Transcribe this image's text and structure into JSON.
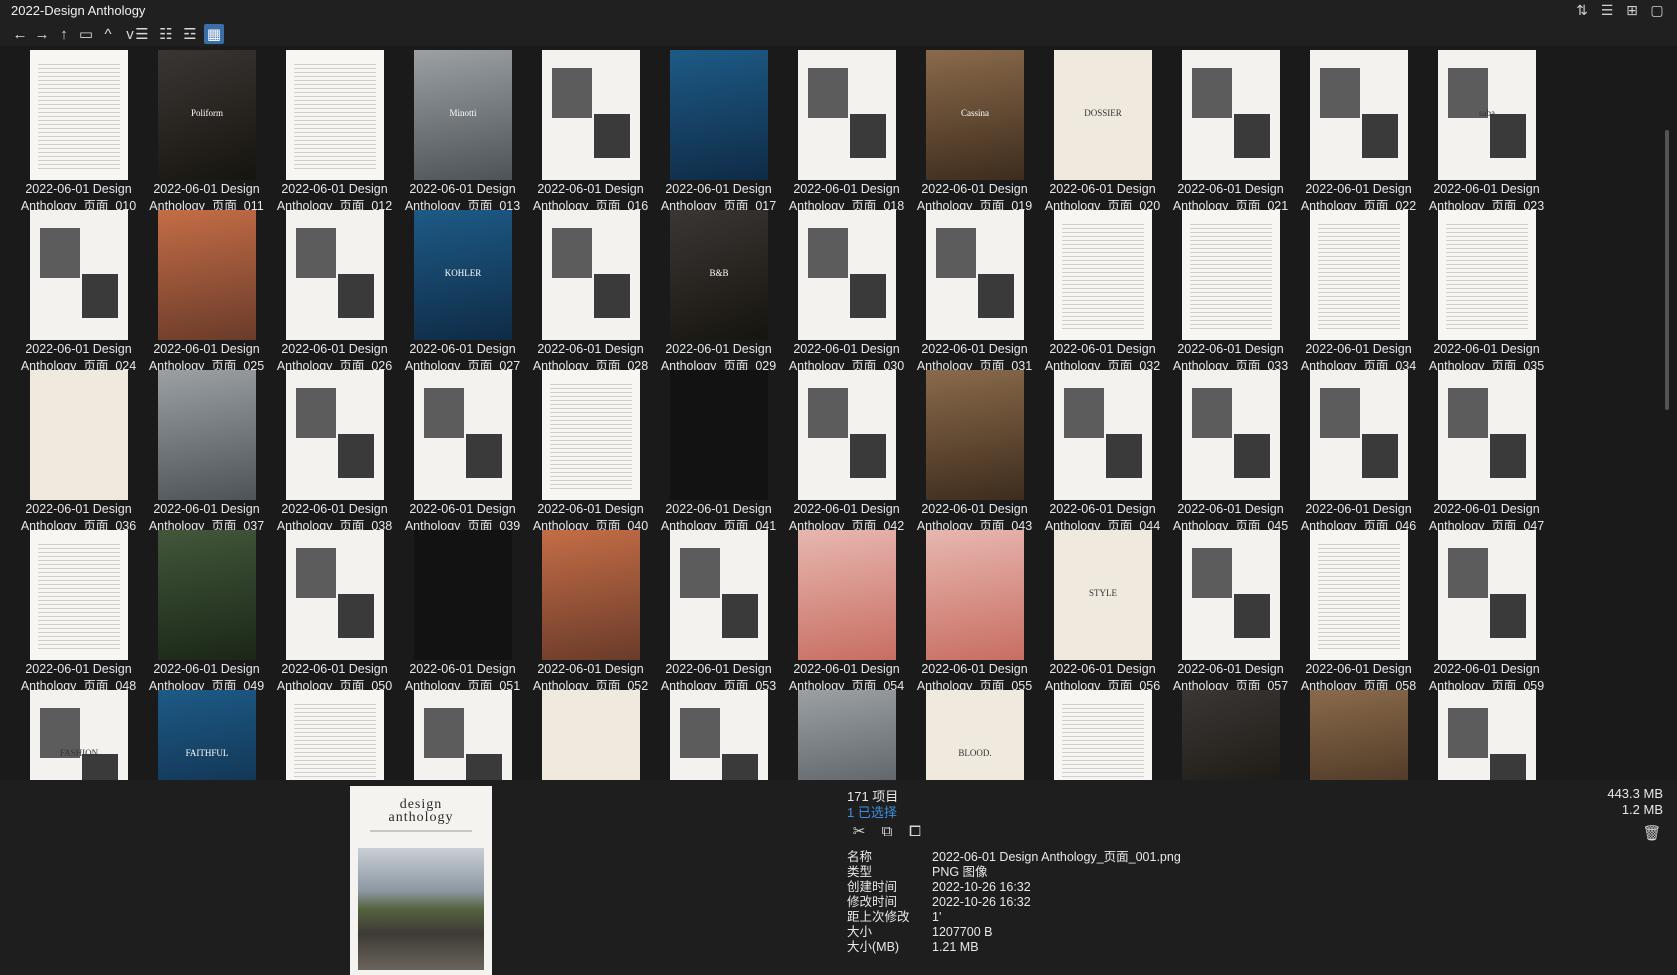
{
  "window": {
    "title": "2022-Design Anthology"
  },
  "toolbar": {
    "back": "←",
    "forward": "→",
    "up": "↑",
    "folder": "▭",
    "caret_up": "^",
    "caret_down": "v",
    "view_list": "☰",
    "view_detail": "☷",
    "view_tiles": "☲",
    "view_thumbs": "▦"
  },
  "titlebar_icons": [
    "⇅",
    "☰",
    "⊞",
    "▢"
  ],
  "files": [
    {
      "line1": "2022-06-01 Design",
      "line2": "Anthology_页面_010",
      "style": "t-text"
    },
    {
      "line1": "2022-06-01 Design",
      "line2": "Anthology_页面_011",
      "style": "t-dark",
      "label": "Poliform"
    },
    {
      "line1": "2022-06-01 Design",
      "line2": "Anthology_页面_012",
      "style": "t-text"
    },
    {
      "line1": "2022-06-01 Design",
      "line2": "Anthology_页面_013",
      "style": "t-grey",
      "label": "Minotti"
    },
    {
      "line1": "2022-06-01 Design",
      "line2": "Anthology_页面_016",
      "style": "t-mag"
    },
    {
      "line1": "2022-06-01 Design",
      "line2": "Anthology_页面_017",
      "style": "t-blue"
    },
    {
      "line1": "2022-06-01 Design",
      "line2": "Anthology_页面_018",
      "style": "t-mag"
    },
    {
      "line1": "2022-06-01 Design",
      "line2": "Anthology_页面_019",
      "style": "t-wood",
      "label": "Cassina"
    },
    {
      "line1": "2022-06-01 Design",
      "line2": "Anthology_页面_020",
      "style": "t-cream",
      "label": "DOSSIER"
    },
    {
      "line1": "2022-06-01 Design",
      "line2": "Anthology_页面_021",
      "style": "t-mag"
    },
    {
      "line1": "2022-06-01 Design",
      "line2": "Anthology_页面_022",
      "style": "t-mag"
    },
    {
      "line1": "2022-06-01 Design",
      "line2": "Anthology_页面_023",
      "style": "t-mag",
      "label": "saba"
    },
    {
      "line1": "2022-06-01 Design",
      "line2": "Anthology_页面_024",
      "style": "t-mag"
    },
    {
      "line1": "2022-06-01 Design",
      "line2": "Anthology_页面_025",
      "style": "t-warm"
    },
    {
      "line1": "2022-06-01 Design",
      "line2": "Anthology_页面_026",
      "style": "t-mag"
    },
    {
      "line1": "2022-06-01 Design",
      "line2": "Anthology_页面_027",
      "style": "t-blue",
      "label": "KOHLER"
    },
    {
      "line1": "2022-06-01 Design",
      "line2": "Anthology_页面_028",
      "style": "t-mag"
    },
    {
      "line1": "2022-06-01 Design",
      "line2": "Anthology_页面_029",
      "style": "t-dark",
      "label": "B&B"
    },
    {
      "line1": "2022-06-01 Design",
      "line2": "Anthology_页面_030",
      "style": "t-mag"
    },
    {
      "line1": "2022-06-01 Design",
      "line2": "Anthology_页面_031",
      "style": "t-mag"
    },
    {
      "line1": "2022-06-01 Design",
      "line2": "Anthology_页面_032",
      "style": "t-text"
    },
    {
      "line1": "2022-06-01 Design",
      "line2": "Anthology_页面_033",
      "style": "t-text"
    },
    {
      "line1": "2022-06-01 Design",
      "line2": "Anthology_页面_034",
      "style": "t-text"
    },
    {
      "line1": "2022-06-01 Design",
      "line2": "Anthology_页面_035",
      "style": "t-text"
    },
    {
      "line1": "2022-06-01 Design",
      "line2": "Anthology_页面_036",
      "style": "t-cream"
    },
    {
      "line1": "2022-06-01 Design",
      "line2": "Anthology_页面_037",
      "style": "t-grey"
    },
    {
      "line1": "2022-06-01 Design",
      "line2": "Anthology_页面_038",
      "style": "t-mag"
    },
    {
      "line1": "2022-06-01 Design",
      "line2": "Anthology_页面_039",
      "style": "t-mag"
    },
    {
      "line1": "2022-06-01 Design",
      "line2": "Anthology_页面_040",
      "style": "t-text"
    },
    {
      "line1": "2022-06-01 Design",
      "line2": "Anthology_页面_041",
      "style": "t-black"
    },
    {
      "line1": "2022-06-01 Design",
      "line2": "Anthology_页面_042",
      "style": "t-mag"
    },
    {
      "line1": "2022-06-01 Design",
      "line2": "Anthology_页面_043",
      "style": "t-wood"
    },
    {
      "line1": "2022-06-01 Design",
      "line2": "Anthology_页面_044",
      "style": "t-mag"
    },
    {
      "line1": "2022-06-01 Design",
      "line2": "Anthology_页面_045",
      "style": "t-mag"
    },
    {
      "line1": "2022-06-01 Design",
      "line2": "Anthology_页面_046",
      "style": "t-mag"
    },
    {
      "line1": "2022-06-01 Design",
      "line2": "Anthology_页面_047",
      "style": "t-mag"
    },
    {
      "line1": "2022-06-01 Design",
      "line2": "Anthology_页面_048",
      "style": "t-text"
    },
    {
      "line1": "2022-06-01 Design",
      "line2": "Anthology_页面_049",
      "style": "t-green"
    },
    {
      "line1": "2022-06-01 Design",
      "line2": "Anthology_页面_050",
      "style": "t-mag"
    },
    {
      "line1": "2022-06-01 Design",
      "line2": "Anthology_页面_051",
      "style": "t-black"
    },
    {
      "line1": "2022-06-01 Design",
      "line2": "Anthology_页面_052",
      "style": "t-warm"
    },
    {
      "line1": "2022-06-01 Design",
      "line2": "Anthology_页面_053",
      "style": "t-mag"
    },
    {
      "line1": "2022-06-01 Design",
      "line2": "Anthology_页面_054",
      "style": "t-pink"
    },
    {
      "line1": "2022-06-01 Design",
      "line2": "Anthology_页面_055",
      "style": "t-pink"
    },
    {
      "line1": "2022-06-01 Design",
      "line2": "Anthology_页面_056",
      "style": "t-cream",
      "label": "STYLE"
    },
    {
      "line1": "2022-06-01 Design",
      "line2": "Anthology_页面_057",
      "style": "t-mag"
    },
    {
      "line1": "2022-06-01 Design",
      "line2": "Anthology_页面_058",
      "style": "t-text"
    },
    {
      "line1": "2022-06-01 Design",
      "line2": "Anthology_页面_059",
      "style": "t-mag"
    },
    {
      "line1": "",
      "line2": "",
      "style": "t-mag",
      "label": "FASHION"
    },
    {
      "line1": "",
      "line2": "",
      "style": "t-blue",
      "label": "FAITHFUL"
    },
    {
      "line1": "",
      "line2": "",
      "style": "t-text"
    },
    {
      "line1": "",
      "line2": "",
      "style": "t-mag"
    },
    {
      "line1": "",
      "line2": "",
      "style": "t-cream"
    },
    {
      "line1": "",
      "line2": "",
      "style": "t-mag"
    },
    {
      "line1": "",
      "line2": "",
      "style": "t-grey"
    },
    {
      "line1": "",
      "line2": "",
      "style": "t-cream",
      "label": "BLOOD."
    },
    {
      "line1": "",
      "line2": "",
      "style": "t-text"
    },
    {
      "line1": "",
      "line2": "",
      "style": "t-dark"
    },
    {
      "line1": "",
      "line2": "",
      "style": "t-wood"
    },
    {
      "line1": "",
      "line2": "",
      "style": "t-mag"
    }
  ],
  "status": {
    "count": "171 项目",
    "selected": "1 已选择",
    "total_size": "443.3 MB",
    "selected_size": "1.2 MB"
  },
  "actions": {
    "cut": "✂",
    "copy": "⧉",
    "open": "⧠",
    "delete": "🗑"
  },
  "preview": {
    "brand_line1": "design",
    "brand_line2": "anthology"
  },
  "properties": [
    {
      "k": "名称",
      "v": "2022-06-01 Design Anthology_页面_001.png"
    },
    {
      "k": "类型",
      "v": "PNG 图像"
    },
    {
      "k": "创建时间",
      "v": "2022-10-26  16:32"
    },
    {
      "k": "修改时间",
      "v": "2022-10-26  16:32"
    },
    {
      "k": "距上次修改",
      "v": "1'"
    },
    {
      "k": "大小",
      "v": "1207700 B"
    },
    {
      "k": "大小(MB)",
      "v": "1.21 MB"
    }
  ],
  "colors": {
    "accent": "#3d8fe0",
    "selected_view": "#3a6ea8",
    "background": "#1a1a1a"
  }
}
